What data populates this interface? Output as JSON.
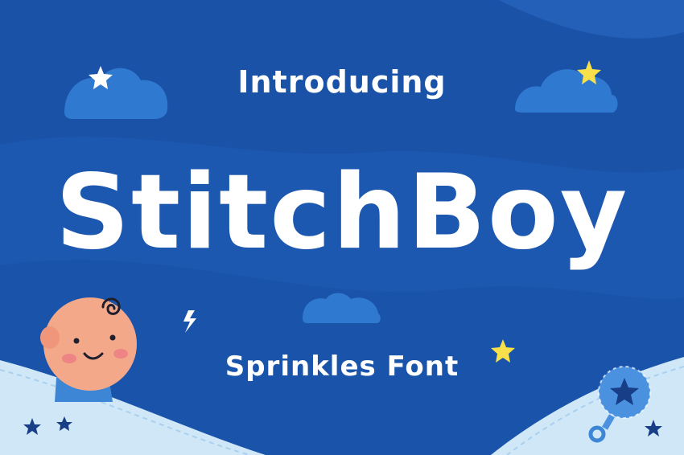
{
  "headline": {
    "intro": "Introducing",
    "title": "StitchBoy",
    "subtitle": "Sprinkles Font"
  },
  "colors": {
    "background": "#1a52a8",
    "background_wave": "#1f5cb8",
    "text": "#ffffff",
    "cloud": "#2f7ad0",
    "star_yellow": "#f7e04a",
    "star_navy": "#173e87",
    "ground": "#cfe7f7"
  },
  "icons": [
    "cloud-icon",
    "star-icon",
    "lightning-icon",
    "baby-illustration",
    "rattle-icon"
  ]
}
